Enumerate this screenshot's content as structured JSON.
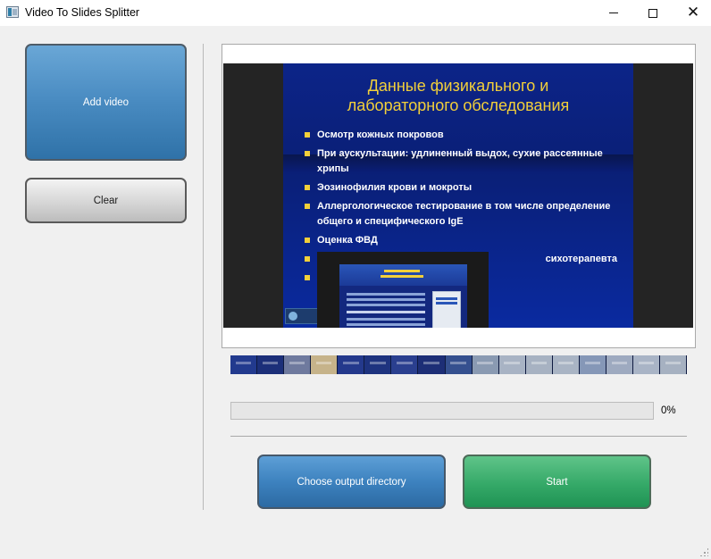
{
  "window": {
    "title": "Video To Slides Splitter",
    "icon": "app-icon",
    "controls": [
      "minimize-icon",
      "maximize-icon",
      "close-icon"
    ],
    "close_glyph": "✕"
  },
  "sidebar": {
    "add_video_label": "Add video",
    "clear_label": "Clear"
  },
  "preview": {
    "slide": {
      "title_line1": "Данные физикального и",
      "title_line2": "лабораторного обследования",
      "bullets": [
        "Осмотр кожных покровов",
        "При аускультации: удлиненный выдох, сухие рассеянные хрипы",
        "Эозинофилия крови и мокроты",
        "Аллергологическое тестирование в том числе определение общего и специфического IgE",
        "Оценка ФВД",
        "сихотерапевта",
        ""
      ]
    }
  },
  "thumbnails": {
    "count": 17,
    "colors": [
      "#223a8e",
      "#1c2f79",
      "#6f7a9e",
      "#c6b38a",
      "#24398c",
      "#1e337f",
      "#2a3f8f",
      "#1d2e76",
      "#35508f",
      "#8a9ab2",
      "#a8b3c4",
      "#a7b2c2",
      "#a9b4c4",
      "#8597b7",
      "#9eaac0",
      "#a9b4c6",
      "#a6b1c1"
    ]
  },
  "progress": {
    "value": 0,
    "label": "0%",
    "color": "#06b025"
  },
  "actions": {
    "choose_dir_label": "Choose output directory",
    "start_label": "Start"
  },
  "colors": {
    "add_button": "#4b8dc3",
    "choose_dir_button": "#3d82bf",
    "start_button": "#35a968",
    "slide_background": "#0a1f76",
    "slide_title": "#f2cf3a"
  }
}
